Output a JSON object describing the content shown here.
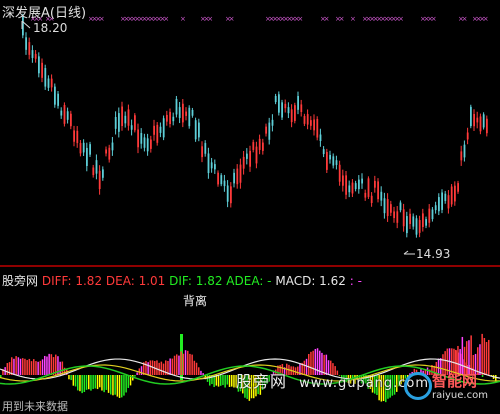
{
  "header": {
    "title": "深发展A(日线)"
  },
  "price_panel": {
    "high_label": "18.20",
    "low_label": "14.93"
  },
  "indicator_panel": {
    "source": "股旁网",
    "diff": "DIFF: 1.82",
    "dea": "DEA: 1.01",
    "dif": "DIF: 1.82",
    "adea": "ADEA: -",
    "macd": "MACD: 1.62",
    "extra": ": -",
    "divergence_label": "背离"
  },
  "watermark": {
    "site_cn": "股旁网",
    "site_url": "www.gupang.com",
    "badge_cn": "智能网",
    "badge_url": "raiyue.com"
  },
  "footer": {
    "note": "用到未来数据"
  },
  "colors": {
    "up": "#ff3a3a",
    "down": "#5ecfd8",
    "marker": "#d45bd4",
    "background": "#000000",
    "divider": "#c00000"
  }
}
